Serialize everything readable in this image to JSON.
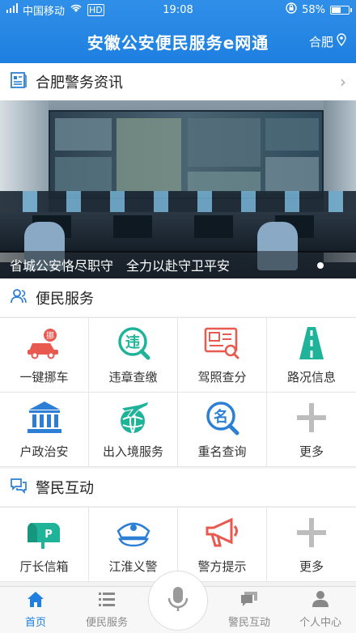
{
  "status_bar": {
    "carrier": "中国移动",
    "time": "19:08",
    "battery": "58%",
    "battery_level": 0.58
  },
  "header": {
    "title": "安徽公安便民服务e网通",
    "city": "合肥"
  },
  "news": {
    "title": "合肥警务资讯",
    "banner_caption": "省城公安恪尽职守　全力以赴守卫平安"
  },
  "service": {
    "title": "便民服务",
    "items": [
      {
        "label": "一键挪车",
        "icon": "car-move-icon"
      },
      {
        "label": "违章查缴",
        "icon": "violation-search-icon"
      },
      {
        "label": "驾照查分",
        "icon": "license-score-icon"
      },
      {
        "label": "路况信息",
        "icon": "road-condition-icon"
      },
      {
        "label": "户政治安",
        "icon": "household-building-icon"
      },
      {
        "label": "出入境服务",
        "icon": "airplane-globe-icon"
      },
      {
        "label": "重名查询",
        "icon": "name-search-icon"
      },
      {
        "label": "更多",
        "icon": "plus-icon"
      }
    ]
  },
  "interaction": {
    "title": "警民互动",
    "items": [
      {
        "label": "厅长信箱",
        "icon": "mailbox-icon"
      },
      {
        "label": "江淮义警",
        "icon": "police-cap-icon"
      },
      {
        "label": "警方提示",
        "icon": "megaphone-icon"
      },
      {
        "label": "更多",
        "icon": "plus-icon"
      }
    ]
  },
  "nav": {
    "home": "首页",
    "service": "便民服务",
    "interaction": "警民互动",
    "personal": "个人中心"
  },
  "colors": {
    "brand": "#1e7fe0",
    "red": "#e8594f",
    "teal": "#1fb39a",
    "blue": "#2d7fd6",
    "gray": "#bdbdbd"
  }
}
